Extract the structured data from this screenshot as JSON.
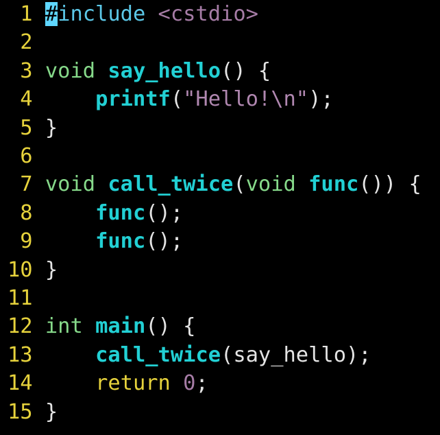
{
  "editor": {
    "colors": {
      "line_number": "#e6d23c",
      "cursor": "#5fd7ff",
      "background": "#000000"
    },
    "cursor": {
      "line": 1,
      "column": 1
    },
    "lines": [
      {
        "n": "1",
        "tokens": [
          {
            "t": "#",
            "k": "cursor"
          },
          {
            "t": "include",
            "k": "preproc"
          },
          {
            "t": " ",
            "k": "punct"
          },
          {
            "t": "<cstdio>",
            "k": "include-path"
          }
        ]
      },
      {
        "n": "2",
        "tokens": []
      },
      {
        "n": "3",
        "tokens": [
          {
            "t": "void",
            "k": "type"
          },
          {
            "t": " ",
            "k": "punct"
          },
          {
            "t": "say_hello",
            "k": "func"
          },
          {
            "t": "() {",
            "k": "punct"
          }
        ]
      },
      {
        "n": "4",
        "tokens": [
          {
            "t": "    ",
            "k": "punct"
          },
          {
            "t": "printf",
            "k": "func"
          },
          {
            "t": "(",
            "k": "punct"
          },
          {
            "t": "\"Hello!\\n\"",
            "k": "string"
          },
          {
            "t": ");",
            "k": "punct"
          }
        ]
      },
      {
        "n": "5",
        "tokens": [
          {
            "t": "}",
            "k": "punct"
          }
        ]
      },
      {
        "n": "6",
        "tokens": []
      },
      {
        "n": "7",
        "tokens": [
          {
            "t": "void",
            "k": "type"
          },
          {
            "t": " ",
            "k": "punct"
          },
          {
            "t": "call_twice",
            "k": "func"
          },
          {
            "t": "(",
            "k": "punct"
          },
          {
            "t": "void",
            "k": "type"
          },
          {
            "t": " ",
            "k": "punct"
          },
          {
            "t": "func",
            "k": "func"
          },
          {
            "t": "()) {",
            "k": "punct"
          }
        ]
      },
      {
        "n": "8",
        "tokens": [
          {
            "t": "    ",
            "k": "punct"
          },
          {
            "t": "func",
            "k": "func"
          },
          {
            "t": "();",
            "k": "punct"
          }
        ]
      },
      {
        "n": "9",
        "tokens": [
          {
            "t": "    ",
            "k": "punct"
          },
          {
            "t": "func",
            "k": "func"
          },
          {
            "t": "();",
            "k": "punct"
          }
        ]
      },
      {
        "n": "10",
        "tokens": [
          {
            "t": "}",
            "k": "punct"
          }
        ]
      },
      {
        "n": "11",
        "tokens": []
      },
      {
        "n": "12",
        "tokens": [
          {
            "t": "int",
            "k": "type"
          },
          {
            "t": " ",
            "k": "punct"
          },
          {
            "t": "main",
            "k": "func"
          },
          {
            "t": "() {",
            "k": "punct"
          }
        ]
      },
      {
        "n": "13",
        "tokens": [
          {
            "t": "    ",
            "k": "punct"
          },
          {
            "t": "call_twice",
            "k": "func"
          },
          {
            "t": "(say_hello);",
            "k": "punct"
          }
        ]
      },
      {
        "n": "14",
        "tokens": [
          {
            "t": "    ",
            "k": "punct"
          },
          {
            "t": "return",
            "k": "keyword"
          },
          {
            "t": " ",
            "k": "punct"
          },
          {
            "t": "0",
            "k": "number"
          },
          {
            "t": ";",
            "k": "punct"
          }
        ]
      },
      {
        "n": "15",
        "tokens": [
          {
            "t": "}",
            "k": "punct"
          }
        ]
      }
    ]
  }
}
